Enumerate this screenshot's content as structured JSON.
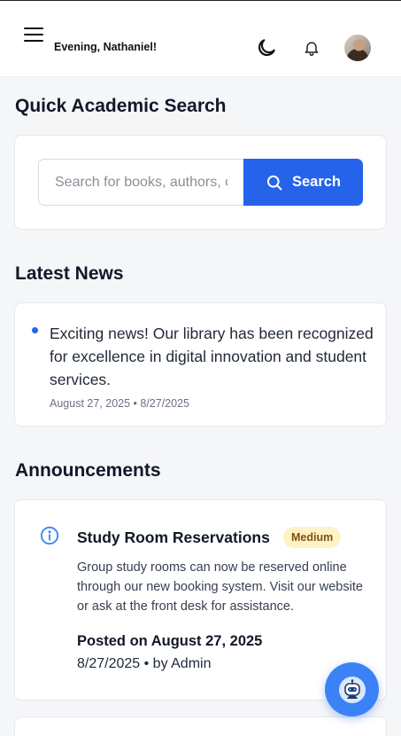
{
  "header": {
    "greeting": "Evening, Nathaniel!"
  },
  "search": {
    "title": "Quick Academic Search",
    "placeholder": "Search for books, authors, or topics...",
    "button_label": "Search"
  },
  "news": {
    "title": "Latest News",
    "items": [
      {
        "text": "Exciting news! Our library has been recognized for excellence in digital innovation and student services.",
        "meta": "August 27, 2025 • 8/27/2025"
      }
    ]
  },
  "announcements": {
    "title": "Announcements",
    "items": [
      {
        "title": "Study Room Reservations",
        "priority": "Medium",
        "body": "Group study rooms can now be reserved online through our new booking system. Visit our website or ask at the front desk for assistance.",
        "posted": "Posted on August 27, 2025",
        "meta": "8/27/2025 • by Admin"
      }
    ]
  },
  "colors": {
    "accent": "#2563eb",
    "badge_bg": "#fef3c7",
    "badge_text": "#854d0e",
    "fab": "#3b82f6"
  },
  "icons": {
    "menu": "menu-icon",
    "theme": "moon-icon",
    "notifications": "bell-icon",
    "search": "search-icon",
    "info": "info-icon",
    "assistant": "chatbot-icon"
  }
}
